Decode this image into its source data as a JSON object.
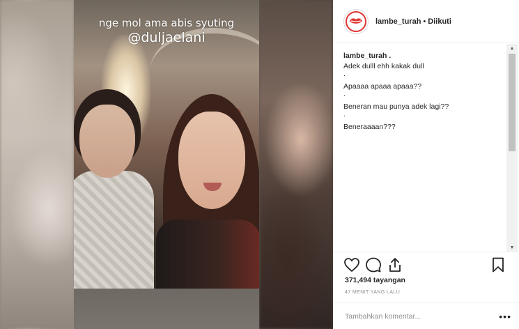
{
  "story": {
    "caption_line1": "nge mol ama abis syuting",
    "caption_line2": "@duljaelani"
  },
  "post": {
    "username": "lambe_turah",
    "separator": "•",
    "follow_status": "Diikuti",
    "avatar_icon": "red-lips-icon",
    "caption_user": "lambe_turah .",
    "caption_lines": [
      "Adek dulll ehh kakak dull",
      ".",
      "Apaaaa apaaa apaaa??",
      ".",
      "Beneran mau punya adek lagi??",
      ".",
      "Beneraaaan???"
    ],
    "actions": {
      "like_icon": "heart-icon",
      "comment_icon": "comment-icon",
      "share_icon": "share-icon",
      "save_icon": "bookmark-icon"
    },
    "views": "371,494 tayangan",
    "time_ago": "47 MENIT YANG LALU",
    "comment_placeholder": "Tambahkan komentar...",
    "more_label": "•••"
  },
  "colors": {
    "brand_red": "#e03434",
    "text": "#262626",
    "muted": "#8e8e8e",
    "divider": "#efefef"
  }
}
